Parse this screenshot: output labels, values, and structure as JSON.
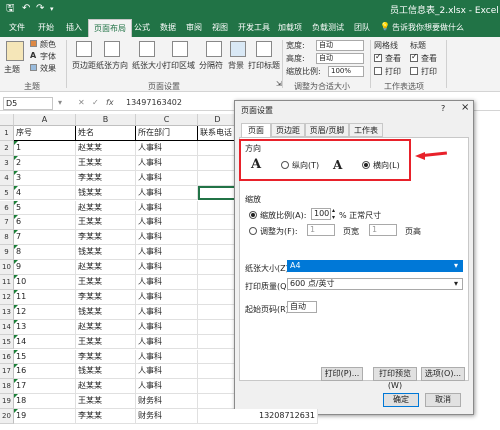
{
  "app": {
    "filename": "员工信息表_2.xlsx - Excel"
  },
  "tabs": [
    "文件",
    "开始",
    "插入",
    "页面布局",
    "公式",
    "数据",
    "审阅",
    "视图",
    "开发工具",
    "加载项",
    "负载测试",
    "团队"
  ],
  "tell_me": "告诉我你想要做什么",
  "ribbon": {
    "themes": {
      "theme": "主题",
      "colors": "颜色",
      "fonts": "字体",
      "effects": "效果",
      "group": "主题"
    },
    "page_setup": {
      "margins": "页边距",
      "orientation": "纸张方向",
      "size": "纸张大小",
      "print_area": "打印区域",
      "breaks": "分隔符",
      "background": "背景",
      "print_titles": "打印标题",
      "group": "页面设置"
    },
    "scale": {
      "width_label": "宽度:",
      "width_value": "自动",
      "height_label": "高度:",
      "height_value": "自动",
      "scale_label": "缩放比例:",
      "scale_value": "100%",
      "group": "调整为合适大小"
    },
    "sheet_options": {
      "gridlines": "网格线",
      "headings": "标题",
      "view": "查看",
      "print": "打印",
      "group": "工作表选项"
    }
  },
  "formula": {
    "namebox": "D5",
    "fx": "fx",
    "value": "13497163402"
  },
  "columns": [
    "A",
    "B",
    "C",
    "D"
  ],
  "headers": [
    "序号",
    "姓名",
    "所在部门",
    "联系电话"
  ],
  "rows": [
    [
      "1",
      "赵某某",
      "人事科"
    ],
    [
      "2",
      "王某某",
      "人事科"
    ],
    [
      "3",
      "李某某",
      "人事科"
    ],
    [
      "4",
      "钱某某",
      "人事科"
    ],
    [
      "5",
      "赵某某",
      "人事科"
    ],
    [
      "6",
      "王某某",
      "人事科"
    ],
    [
      "7",
      "李某某",
      "人事科"
    ],
    [
      "8",
      "钱某某",
      "人事科"
    ],
    [
      "9",
      "赵某某",
      "人事科"
    ],
    [
      "10",
      "王某某",
      "人事科"
    ],
    [
      "11",
      "李某某",
      "人事科"
    ],
    [
      "12",
      "钱某某",
      "人事科"
    ],
    [
      "13",
      "赵某某",
      "人事科"
    ],
    [
      "14",
      "王某某",
      "人事科"
    ],
    [
      "15",
      "李某某",
      "人事科"
    ],
    [
      "16",
      "钱某某",
      "人事科"
    ],
    [
      "17",
      "赵某某",
      "人事科"
    ],
    [
      "18",
      "王某某",
      "财务科"
    ],
    [
      "19",
      "李某某",
      "财务科"
    ]
  ],
  "last_phone": "13208712631",
  "dialog": {
    "title": "页面设置",
    "help": "?",
    "close": "×",
    "tabs": [
      "页面",
      "页边距",
      "页眉/页脚",
      "工作表"
    ],
    "orientation_label": "方向",
    "portrait": "纵向(T)",
    "landscape": "横向(L)",
    "glyph": "A",
    "scaling_label": "缩放",
    "adjust_to": "缩放比例(A):",
    "adjust_value": "100",
    "adjust_unit": "% 正常尺寸",
    "fit_to": "调整为(F):",
    "fit_w": "1",
    "fit_w_unit": "页宽",
    "fit_h": "1",
    "fit_h_unit": "页高",
    "paper_size_label": "纸张大小(Z):",
    "paper_size": "A4",
    "quality_label": "打印质量(Q):",
    "quality": "600 点/英寸",
    "first_page_label": "起始页码(R):",
    "first_page": "自动",
    "print_btn": "打印(P)...",
    "preview_btn": "打印预览(W)",
    "options_btn": "选项(O)...",
    "ok_btn": "确定",
    "cancel_btn": "取消"
  },
  "colors": {
    "excel_green": "#217346",
    "highlight": "#e8212a",
    "select_blue": "#0078d7"
  }
}
